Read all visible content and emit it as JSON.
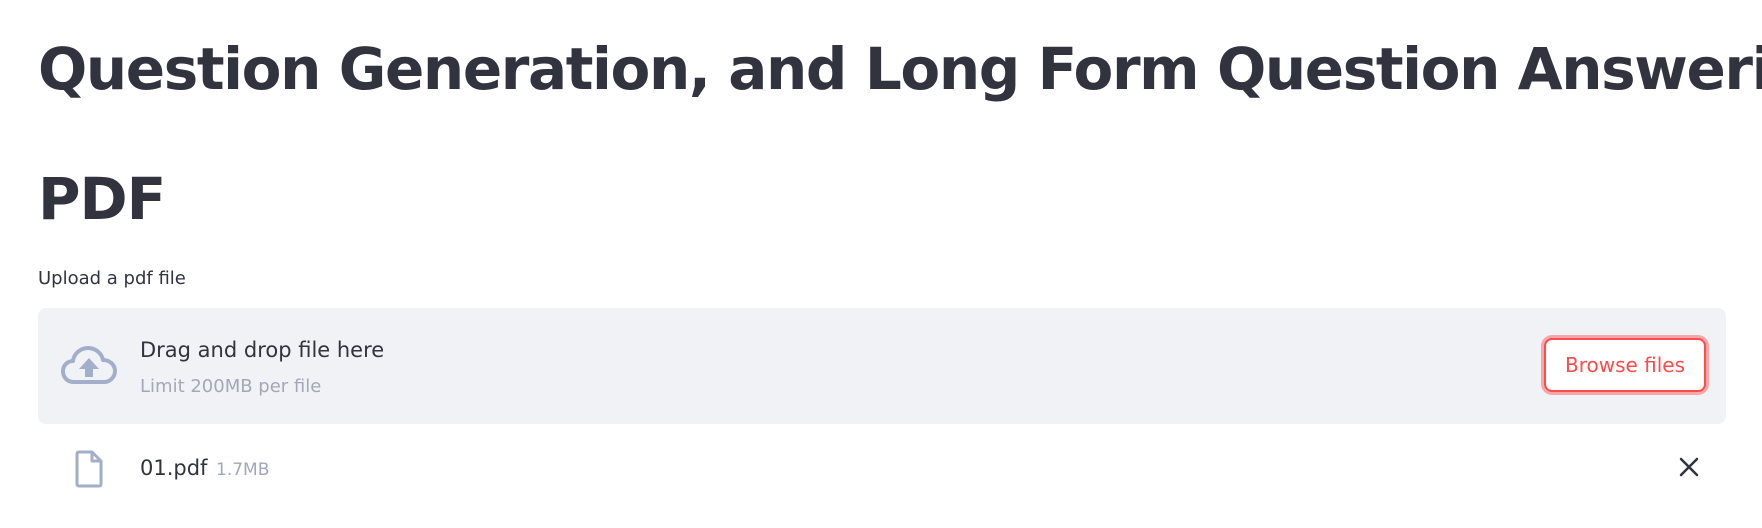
{
  "main": {
    "title": "Question Generation, and Long Form Question Answering",
    "section_title": "PDF"
  },
  "uploader": {
    "label": "Upload a pdf file",
    "drop_text": "Drag and drop file here",
    "limit_text": "Limit 200MB per file",
    "browse_label": "Browse files",
    "icon": "cloud-upload-icon"
  },
  "uploaded_file": {
    "name": "01.pdf",
    "size": "1.7MB",
    "icon": "file-icon",
    "remove_icon": "close-icon"
  },
  "colors": {
    "text": "#31333f",
    "accent": "#ff4b4b",
    "muted": "#a3a8b8",
    "icon": "#a3aecb",
    "dropzone_bg": "#f0f2f6"
  }
}
